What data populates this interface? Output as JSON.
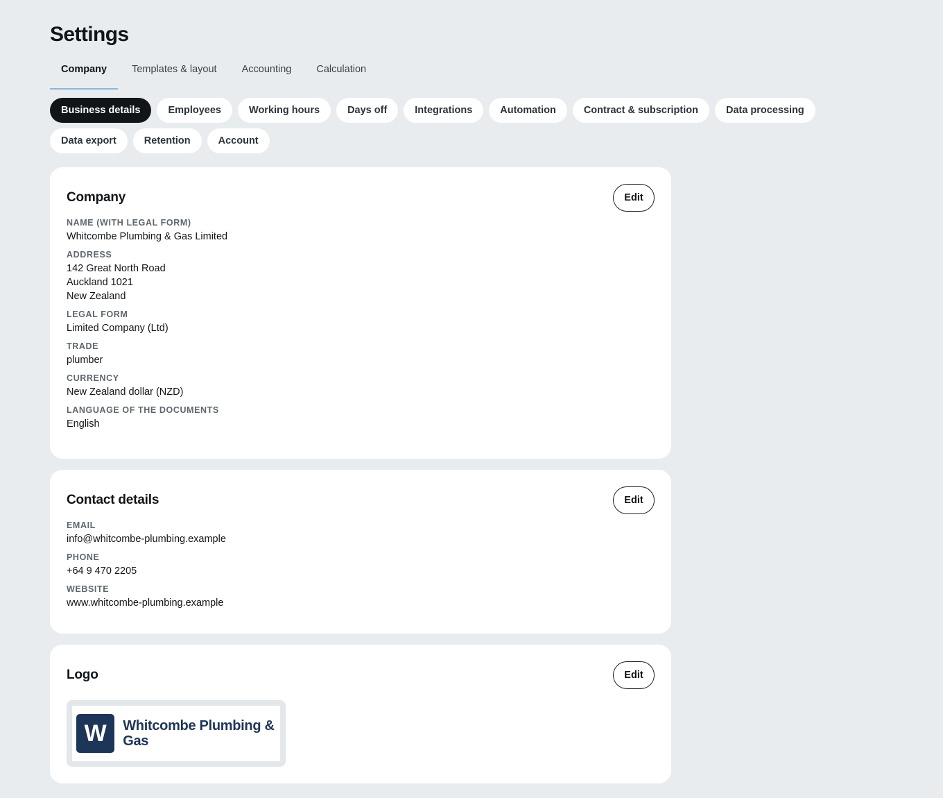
{
  "page": {
    "title": "Settings"
  },
  "tabs": [
    {
      "label": "Company",
      "active": true
    },
    {
      "label": "Templates & layout",
      "active": false
    },
    {
      "label": "Accounting",
      "active": false
    },
    {
      "label": "Calculation",
      "active": false
    }
  ],
  "pills": [
    {
      "label": "Business details",
      "active": true
    },
    {
      "label": "Employees",
      "active": false
    },
    {
      "label": "Working hours",
      "active": false
    },
    {
      "label": "Days off",
      "active": false
    },
    {
      "label": "Integrations",
      "active": false
    },
    {
      "label": "Automation",
      "active": false
    },
    {
      "label": "Contract & subscription",
      "active": false
    },
    {
      "label": "Data processing",
      "active": false
    },
    {
      "label": "Data export",
      "active": false
    },
    {
      "label": "Retention",
      "active": false
    },
    {
      "label": "Account",
      "active": false
    }
  ],
  "company": {
    "title": "Company",
    "edit_label": "Edit",
    "name_label": "Name (with legal form)",
    "name_value": "Whitcombe Plumbing & Gas Limited",
    "address_label": "Address",
    "address_lines": [
      "142 Great North Road",
      "Auckland 1021",
      "New Zealand"
    ],
    "legal_form_label": "Legal form",
    "legal_form_value": "Limited Company (Ltd)",
    "trade_label": "Trade",
    "trade_value": "plumber",
    "currency_label": "Currency",
    "currency_value": "New Zealand dollar (NZD)",
    "language_label": "Language of the documents",
    "language_value": "English"
  },
  "contact": {
    "title": "Contact details",
    "edit_label": "Edit",
    "email_label": "Email",
    "email_value": "info@whitcombe-plumbing.example",
    "phone_label": "Phone",
    "phone_value": "+64 9 470 2205",
    "website_label": "Website",
    "website_value": "www.whitcombe-plumbing.example"
  },
  "logo": {
    "title": "Logo",
    "edit_label": "Edit",
    "mark_letter": "W",
    "brand_text": "Whitcombe Plumbing & Gas",
    "brand_color": "#1d3557"
  },
  "colors": {
    "background": "#e8ecef",
    "active_pill": "#111418",
    "tab_underline": "#8fb7d6"
  }
}
